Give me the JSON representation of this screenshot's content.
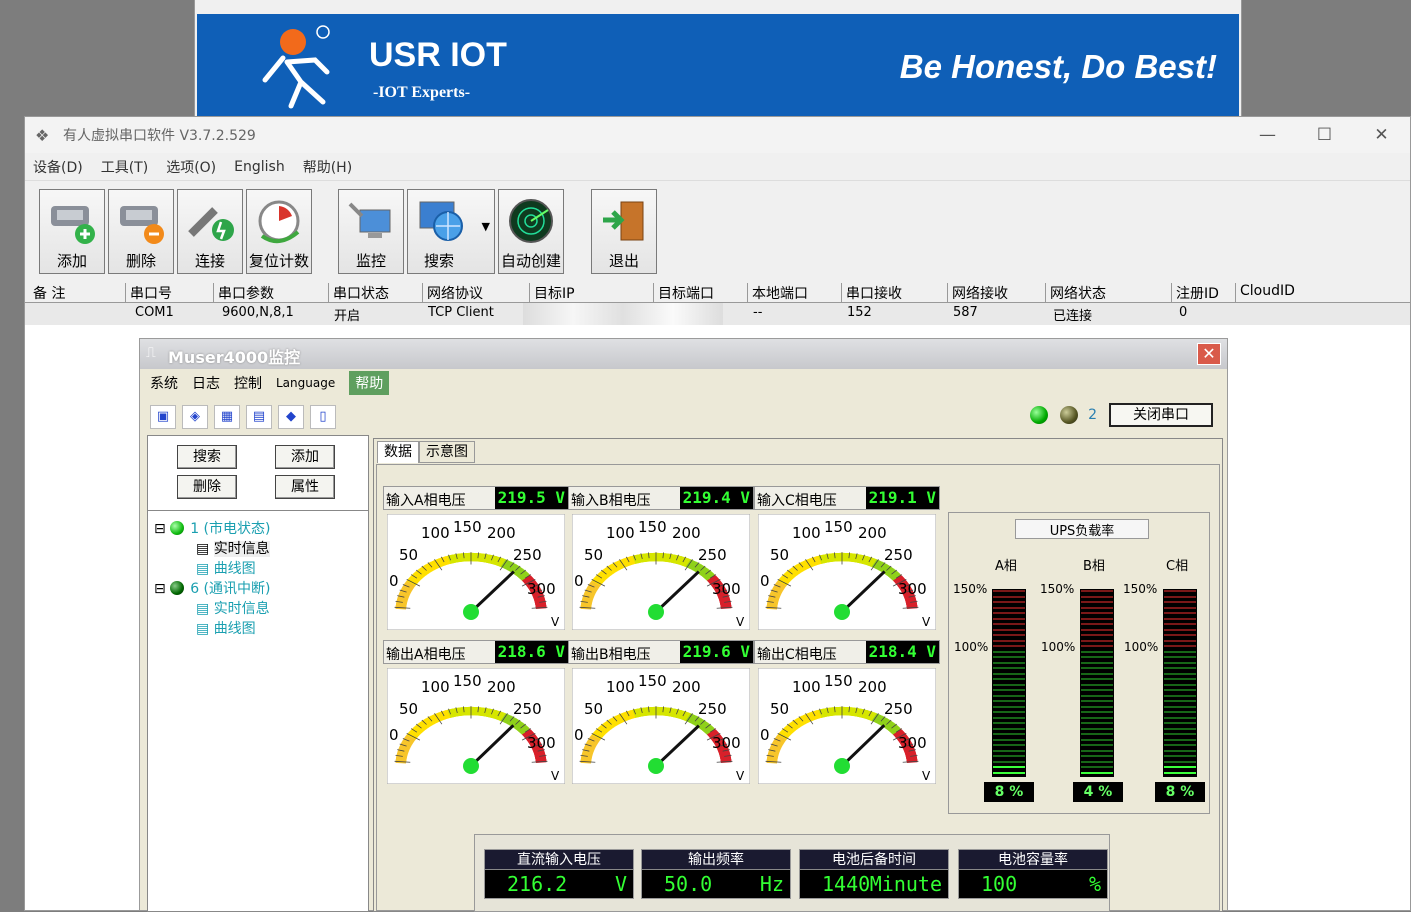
{
  "banner": {
    "title": "USR IOT",
    "subtitle": "-IOT Experts-",
    "slogan": "Be Honest, Do Best!",
    "brand_color": "#0f5fb7"
  },
  "app": {
    "title": "有人虚拟串口软件 V3.7.2.529"
  },
  "menu": [
    "设备(D)",
    "工具(T)",
    "选项(O)",
    "English",
    "帮助(H)"
  ],
  "toolbar": {
    "add": "添加",
    "delete": "删除",
    "connect": "连接",
    "reset": "复位计数",
    "monitor": "监控",
    "search": "搜索",
    "auto_create": "自动创建",
    "exit": "退出"
  },
  "grid": {
    "columns": [
      "备 注",
      "串口号",
      "串口参数",
      "串口状态",
      "网络协议",
      "目标IP",
      "目标端口",
      "本地端口",
      "串口接收",
      "网络接收",
      "网络状态",
      "注册ID",
      "CloudID"
    ],
    "row": {
      "port": "COM1",
      "params": "9600,N,8,1",
      "state": "开启",
      "protocol": "TCP Client",
      "local_port": "--",
      "serial_rx": "152",
      "net_rx": "587",
      "net_state": "已连接",
      "reg_id": "0"
    }
  },
  "monitor": {
    "title": "Muser4000监控",
    "menu": [
      "系统",
      "日志",
      "控制",
      "Language",
      "帮助"
    ],
    "close_port": "关闭串口",
    "count": "2",
    "buttons": {
      "search": "搜索",
      "add": "添加",
      "delete": "删除",
      "props": "属性"
    },
    "tree": [
      {
        "label": "1 (市电状态)",
        "children": [
          "实时信息",
          "曲线图"
        ]
      },
      {
        "label": "6 (通讯中断)",
        "children": [
          "实时信息",
          "曲线图"
        ]
      }
    ],
    "tabs": [
      "数据",
      "示意图"
    ],
    "gauges": [
      {
        "label": "输入A相电压",
        "value": "219.5 V",
        "reading": 219.5
      },
      {
        "label": "输入B相电压",
        "value": "219.4 V",
        "reading": 219.4
      },
      {
        "label": "输入C相电压",
        "value": "219.1 V",
        "reading": 219.1
      },
      {
        "label": "输出A相电压",
        "value": "218.6 V",
        "reading": 218.6
      },
      {
        "label": "输出B相电压",
        "value": "219.6 V",
        "reading": 219.6
      },
      {
        "label": "输出C相电压",
        "value": "218.4 V",
        "reading": 218.4
      }
    ],
    "gauge_ticks": [
      "0",
      "50",
      "100",
      "150",
      "200",
      "250",
      "300"
    ],
    "gauge_unit": "V",
    "ups": {
      "title": "UPS负载率",
      "phases": [
        {
          "name": "A相",
          "pct": "8 %",
          "level": 8
        },
        {
          "name": "B相",
          "pct": "4 %",
          "level": 4
        },
        {
          "name": "C相",
          "pct": "8 %",
          "level": 8
        }
      ],
      "marks": [
        "150%",
        "100%"
      ]
    },
    "bottom": [
      {
        "label": "直流输入电压",
        "value": "216.2",
        "unit": "V"
      },
      {
        "label": "输出频率",
        "value": "50.0",
        "unit": "Hz"
      },
      {
        "label": "电池后备时间",
        "value": "1440",
        "unit": "Minute"
      },
      {
        "label": "电池容量率",
        "value": "100",
        "unit": "%"
      }
    ]
  }
}
